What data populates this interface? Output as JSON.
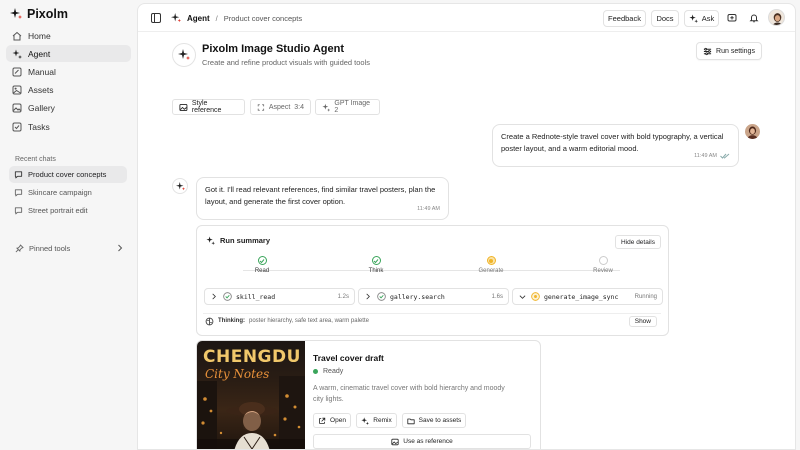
{
  "app": {
    "name": "Pixolm"
  },
  "sidebar": {
    "nav": [
      {
        "label": "Home",
        "icon": "home-icon"
      },
      {
        "label": "Agent",
        "icon": "sparkle-icon",
        "active": true
      },
      {
        "label": "Manual",
        "icon": "manual-icon"
      },
      {
        "label": "Assets",
        "icon": "assets-icon"
      },
      {
        "label": "Gallery",
        "icon": "gallery-icon"
      },
      {
        "label": "Tasks",
        "icon": "tasks-icon"
      }
    ],
    "recent_label": "Recent chats",
    "recent": [
      {
        "label": "Product cover concepts",
        "active": true
      },
      {
        "label": "Skincare campaign"
      },
      {
        "label": "Street portrait edit"
      }
    ],
    "pinned_label": "Pinned tools"
  },
  "topbar": {
    "crumb_agent": "Agent",
    "crumb_sep": "/",
    "crumb_page": "Product cover concepts",
    "feedback": "Feedback",
    "docs": "Docs",
    "ask": "Ask"
  },
  "agent": {
    "title": "Pixolm Image Studio Agent",
    "subtitle": "Create and refine product visuals with guided tools",
    "run_settings": "Run settings"
  },
  "chips": {
    "style": "Style reference",
    "aspect_label": "Aspect",
    "aspect_value": "3:4",
    "model": "GPT Image 2"
  },
  "messages": {
    "user_text": "Create a Rednote-style travel cover with bold typography, a vertical poster layout, and a warm editorial mood.",
    "user_time": "11:49 AM",
    "agent_text": "Got it. I'll read relevant references, find similar travel posters, plan the layout, and generate the first cover option.",
    "agent_time": "11:49 AM"
  },
  "run_summary": {
    "title": "Run summary",
    "hide_details": "Hide details",
    "steps": [
      {
        "label": "Read",
        "state": "done"
      },
      {
        "label": "Think",
        "state": "done"
      },
      {
        "label": "Generate",
        "state": "running"
      },
      {
        "label": "Review",
        "state": "pending"
      }
    ],
    "tools": [
      {
        "name": "skill_read",
        "time": "1.2s"
      },
      {
        "name": "gallery.search",
        "time": "1.6s"
      },
      {
        "name": "generate_image_sync",
        "time": "Running"
      }
    ],
    "thinking_label": "Thinking:",
    "thinking_text": "poster hierarchy, safe text area, warm palette",
    "show": "Show"
  },
  "draft": {
    "title": "Travel cover draft",
    "status": "Ready",
    "description": "A warm, cinematic travel cover with bold hierarchy and moody city lights.",
    "poster_title": "CHENGDU",
    "poster_subtitle": "City Notes",
    "open": "Open",
    "remix": "Remix",
    "save": "Save to assets",
    "use_ref": "Use as reference"
  },
  "colors": {
    "accent_running": "#f0b429",
    "done_green": "#3aa55b",
    "poster_title": "#f1c86b"
  }
}
